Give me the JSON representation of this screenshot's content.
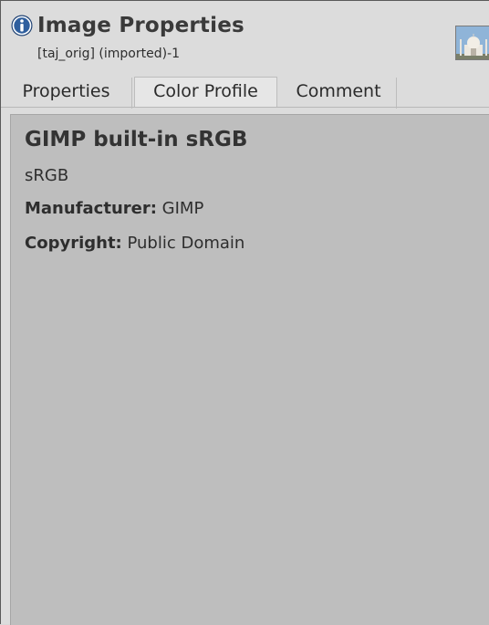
{
  "header": {
    "title": "Image Properties",
    "subtitle": "[taj_orig] (imported)-1",
    "icon": "info-icon",
    "thumbnail": "image-thumbnail"
  },
  "tabs": [
    {
      "label": "Properties",
      "active": false
    },
    {
      "label": "Color Profile",
      "active": true
    },
    {
      "label": "Comment",
      "active": false
    }
  ],
  "profile": {
    "name": "GIMP built-in sRGB",
    "description": "sRGB",
    "manufacturer_label": "Manufacturer:",
    "manufacturer_value": "GIMP",
    "copyright_label": "Copyright:",
    "copyright_value": "Public Domain"
  },
  "colors": {
    "info_icon": "#2f5f9e",
    "content_bg": "#bebebe",
    "window_bg": "#dcdcdc"
  }
}
